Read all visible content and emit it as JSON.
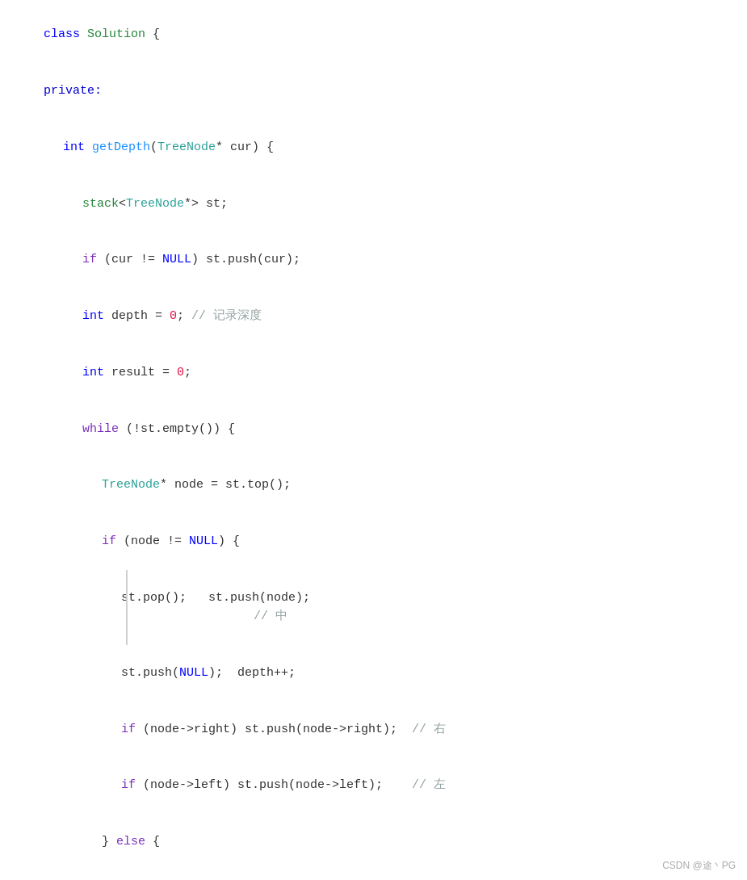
{
  "footer": "CSDN @途丶PG",
  "code": {
    "lines": []
  }
}
